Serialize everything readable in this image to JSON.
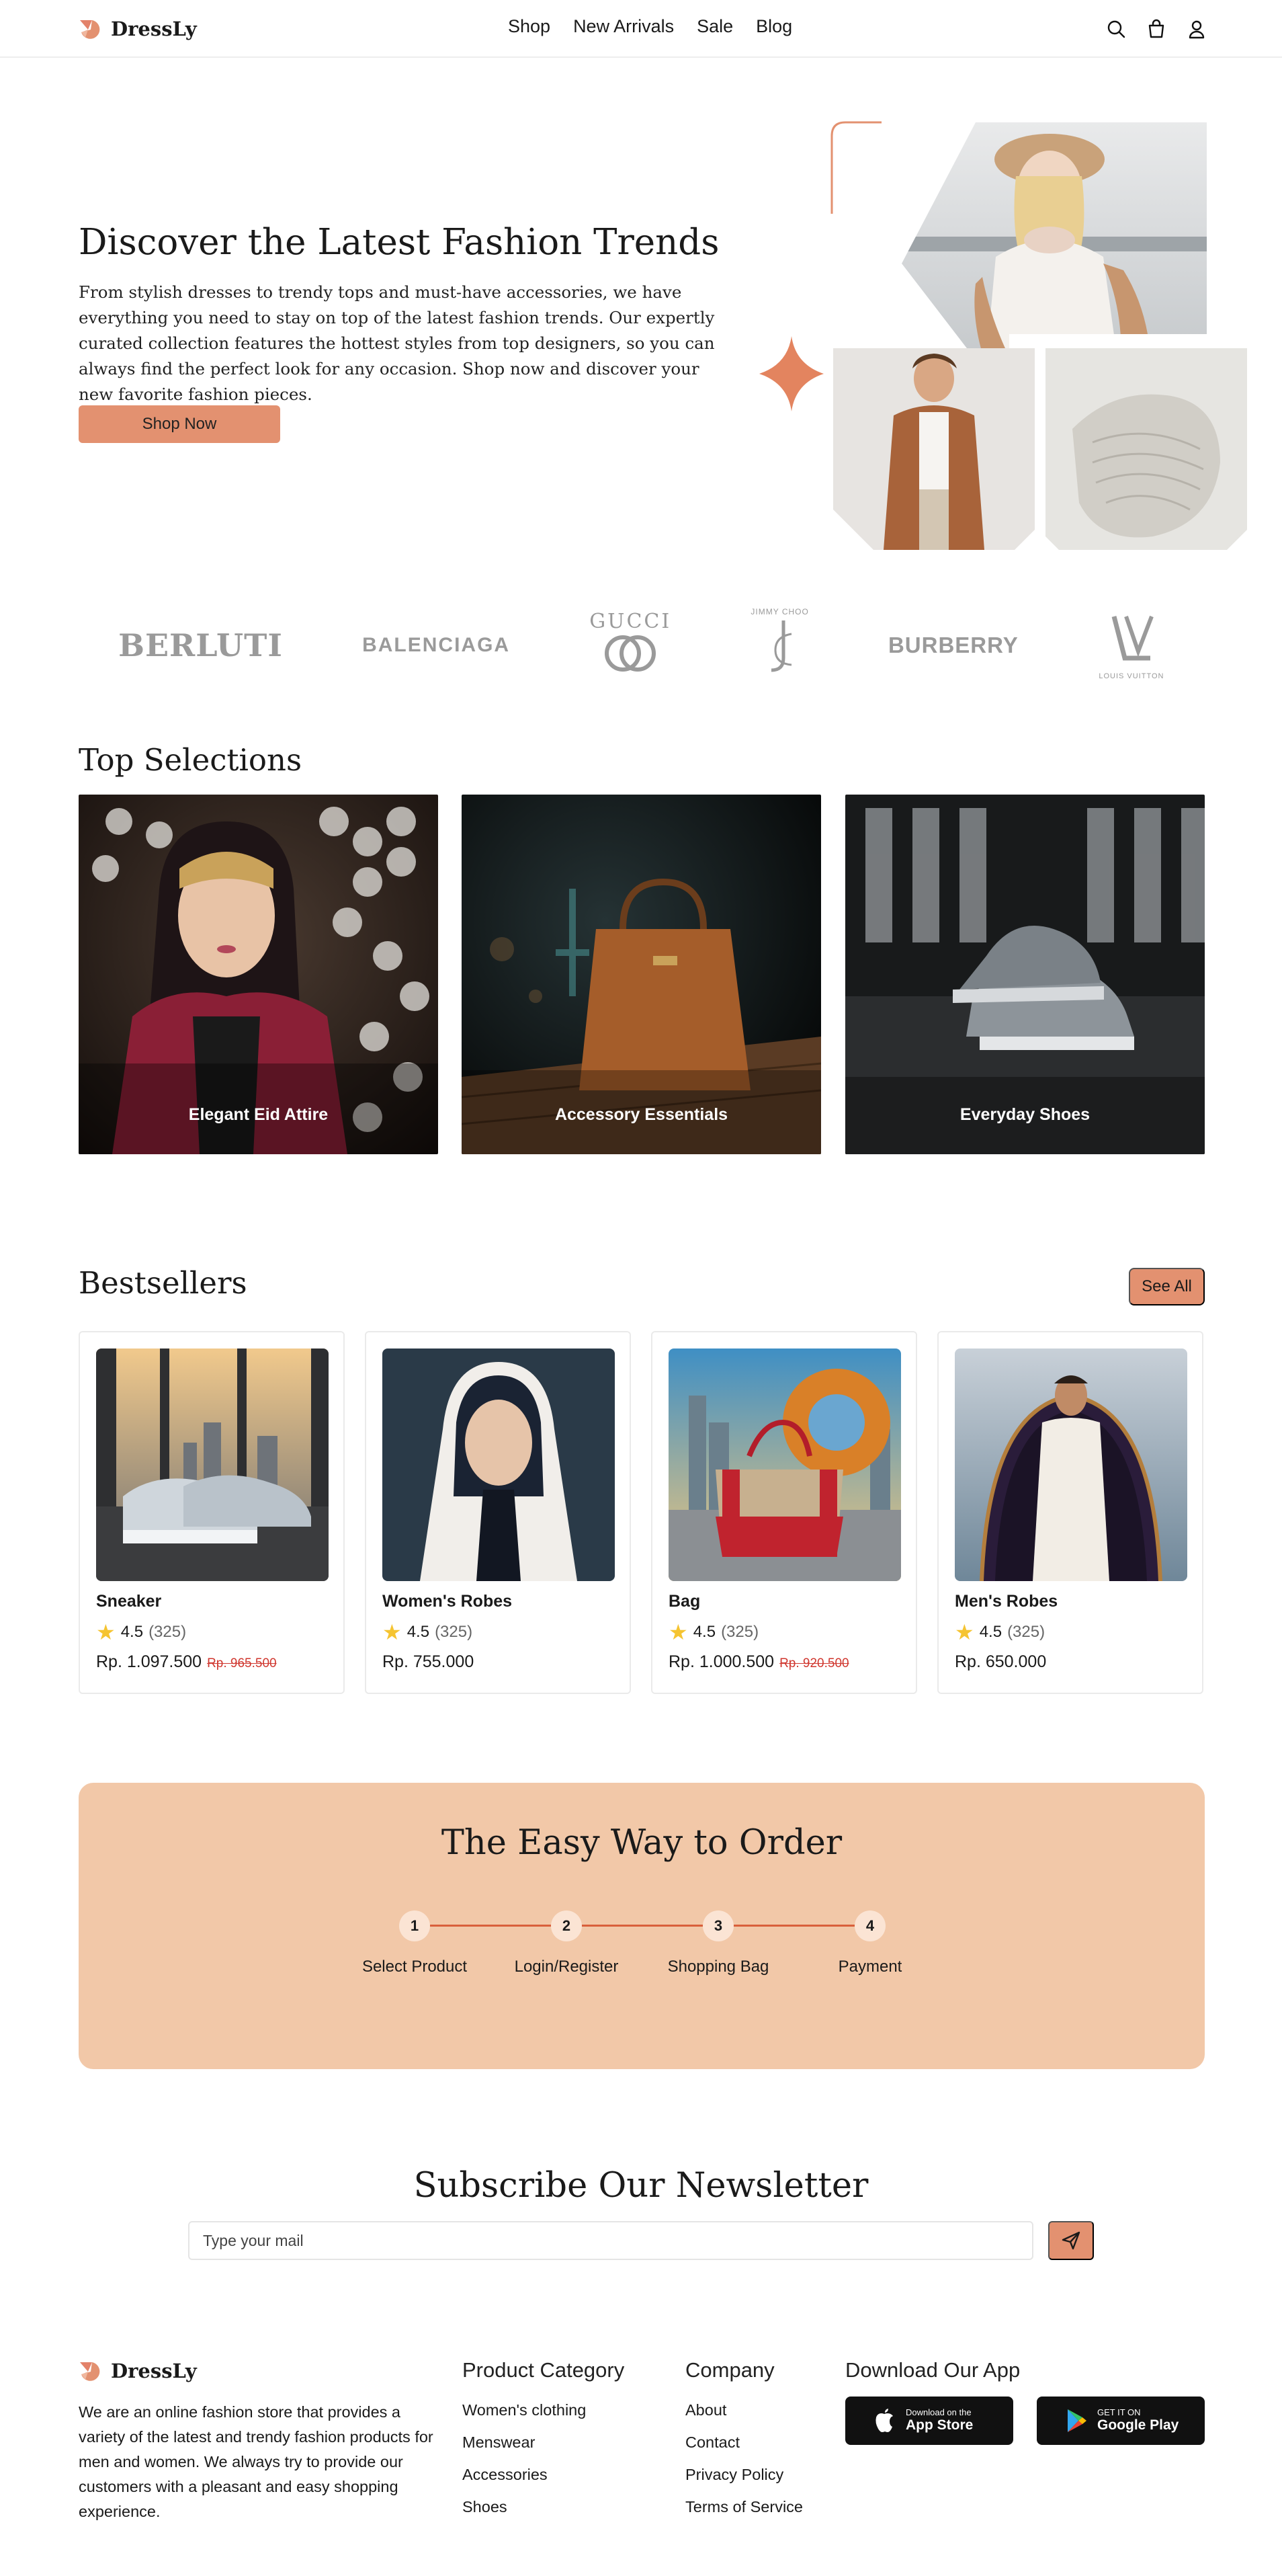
{
  "brand": {
    "name": "DressLy"
  },
  "nav": {
    "links": [
      "Shop",
      "New Arrivals",
      "Sale",
      "Blog"
    ]
  },
  "hero": {
    "title": "Discover the Latest Fashion Trends",
    "text": "From stylish dresses to trendy tops and must-have accessories, we have everything you need to stay on top of the latest fashion trends. Our expertly curated collection features the hottest styles from top designers, so you can always find the perfect look for any occasion. Shop now and discover your new favorite fashion pieces.",
    "button": "Shop Now"
  },
  "brands": [
    "BERLUTI",
    "BALENCIAGA",
    "GUCCI",
    "JIMMY CHOO",
    "BURBERRY",
    "LOUIS VUITTON"
  ],
  "top_selections": {
    "title": "Top Selections",
    "items": [
      {
        "label": "Elegant Eid Attire"
      },
      {
        "label": "Accessory Essentials"
      },
      {
        "label": "Everyday Shoes"
      }
    ]
  },
  "bestsellers": {
    "title": "Bestsellers",
    "see_all": "See All",
    "products": [
      {
        "name": "Sneaker",
        "rating": "4.5",
        "count": "(325)",
        "price": "Rp. 1.097.500",
        "old_price": "Rp. 965.500"
      },
      {
        "name": "Women's Robes",
        "rating": "4.5",
        "count": "(325)",
        "price": "Rp. 755.000",
        "old_price": ""
      },
      {
        "name": "Bag",
        "rating": "4.5",
        "count": "(325)",
        "price": "Rp. 1.000.500",
        "old_price": "Rp. 920.500"
      },
      {
        "name": "Men's Robes",
        "rating": "4.5",
        "count": "(325)",
        "price": "Rp. 650.000",
        "old_price": ""
      }
    ]
  },
  "order": {
    "title": "The Easy Way to Order",
    "steps": [
      {
        "num": "1",
        "label": "Select Product"
      },
      {
        "num": "2",
        "label": "Login/Register"
      },
      {
        "num": "3",
        "label": "Shopping Bag"
      },
      {
        "num": "4",
        "label": "Payment"
      }
    ]
  },
  "newsletter": {
    "title": "Subscribe Our Newsletter",
    "placeholder": "Type your mail"
  },
  "footer": {
    "about": "We are an online fashion store that provides a variety of the latest and trendy fashion products for men and women. We always try to provide our customers with a pleasant and easy shopping experience.",
    "product_category": {
      "title": "Product Category",
      "items": [
        "Women's clothing",
        "Menswear",
        "Accessories",
        "Shoes"
      ]
    },
    "company": {
      "title": "Company",
      "items": [
        "About",
        "Contact",
        "Privacy Policy",
        "Terms of Service"
      ]
    },
    "app": {
      "title": "Download Our App",
      "app_store": {
        "small": "Download on the",
        "big": "App Store"
      },
      "google_play": {
        "small": "GET IT ON",
        "big": "Google Play"
      }
    }
  },
  "colors": {
    "accent": "#e39170",
    "banner": "#f2c8a8",
    "line": "#d9603b"
  }
}
